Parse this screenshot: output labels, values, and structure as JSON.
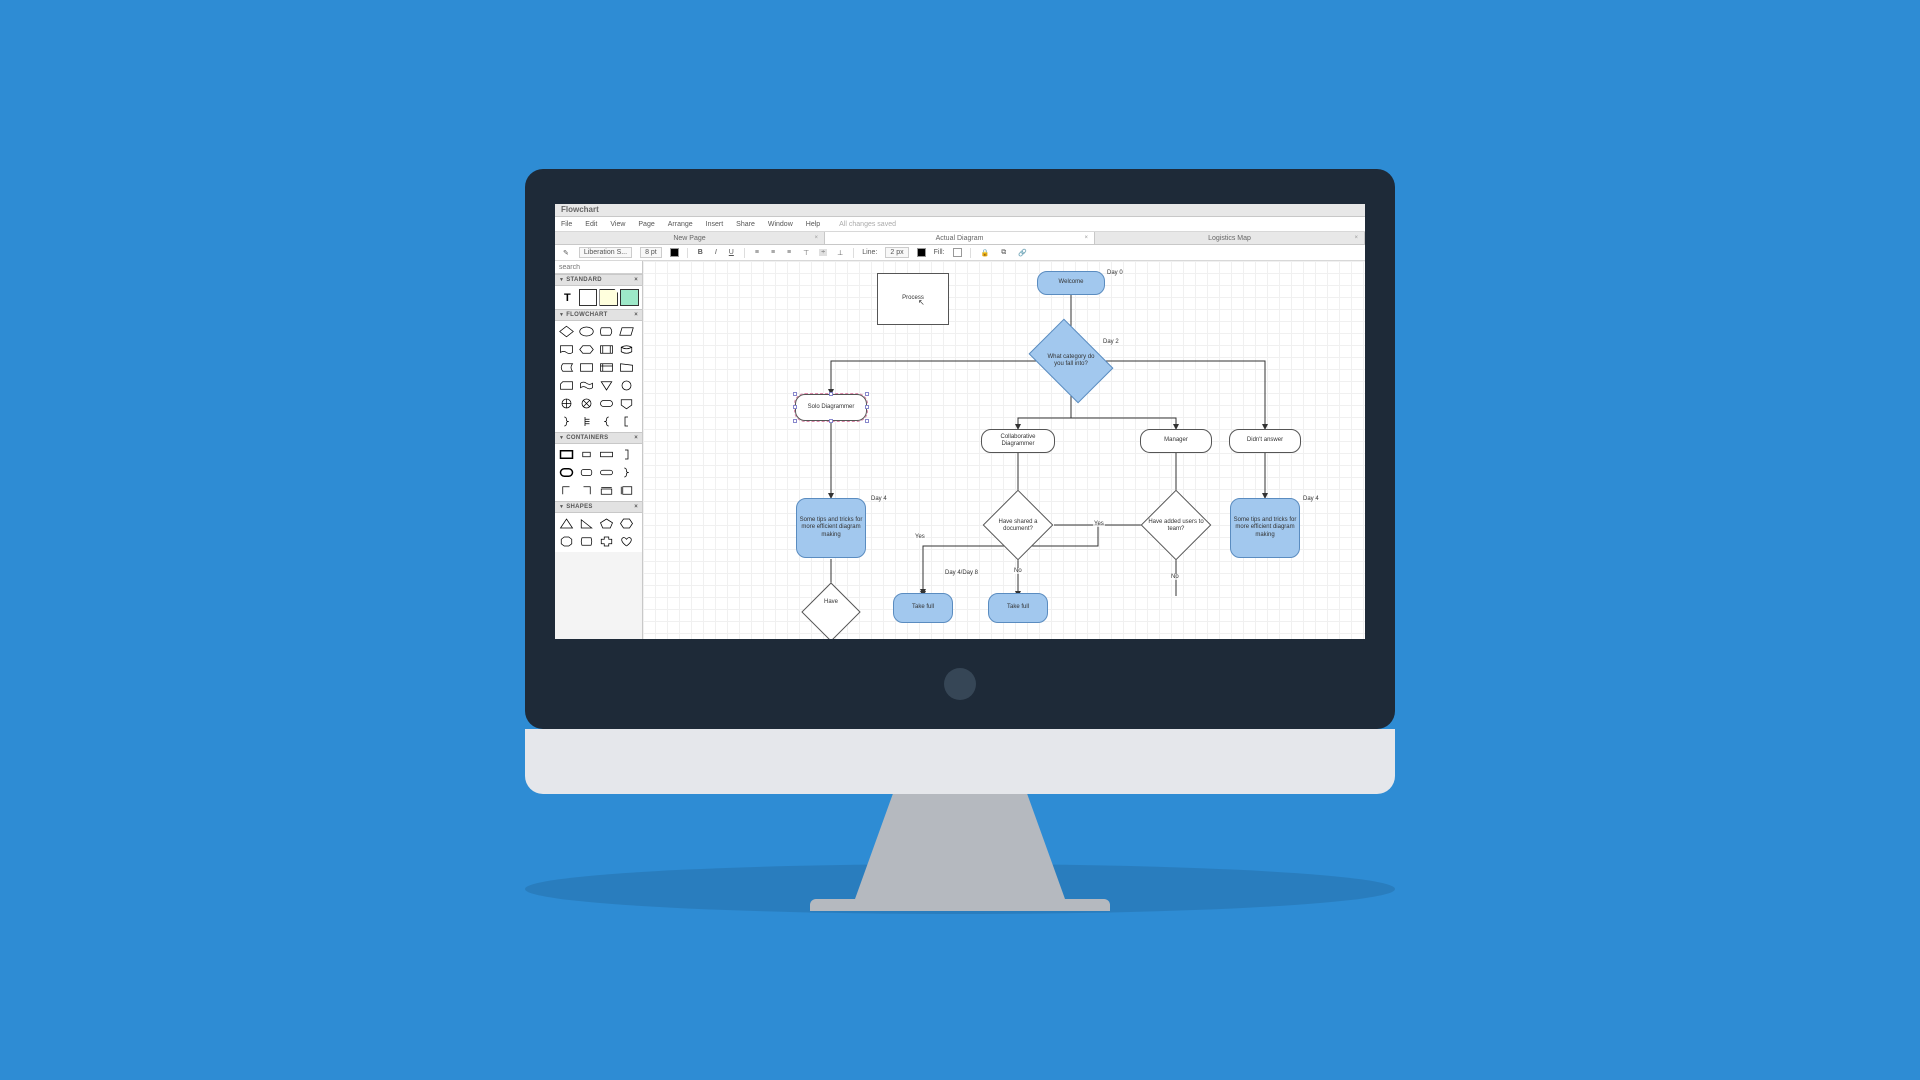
{
  "app": {
    "title": "Flowchart",
    "status": "All changes saved"
  },
  "menus": [
    "File",
    "Edit",
    "View",
    "Page",
    "Arrange",
    "Insert",
    "Share",
    "Window",
    "Help"
  ],
  "tabs": [
    {
      "label": "New Page",
      "active": false
    },
    {
      "label": "Actual Diagram",
      "active": true
    },
    {
      "label": "Logistics Map",
      "active": false
    }
  ],
  "toolbar": {
    "font": "Liberation S...",
    "fontSize": "8 pt",
    "textColor": "#000000",
    "lineLabel": "Line:",
    "lineWidth": "2 px",
    "lineColor": "#000000",
    "fillLabel": "Fill:",
    "fillColor": "#ffffff"
  },
  "panel": {
    "searchPlaceholder": "search",
    "sections": {
      "standard": "STANDARD",
      "flowchart": "FLOWCHART",
      "containers": "CONTAINERS",
      "shapes": "SHAPES"
    }
  },
  "diagram": {
    "nodes": {
      "process": "Process",
      "welcome": "Welcome",
      "category": "What category do you fall into?",
      "solo": "Solo Diagrammer",
      "collab": "Collaborative Diagrammer",
      "manager": "Manager",
      "noanswer": "Didn't answer",
      "tips1": "Some tips and tricks for more efficient diagram making",
      "tips2": "Some tips and tricks for more efficient diagram making",
      "shared": "Have shared a document?",
      "added": "Have added users to team?",
      "have": "Have",
      "takefull1": "Take full",
      "takefull2": "Take full"
    },
    "labels": {
      "day0": "Day 0",
      "day2": "Day 2",
      "day4a": "Day 4",
      "day4b": "Day 4",
      "day48": "Day 4/Day 8"
    },
    "edges": {
      "yes": "Yes",
      "no": "No"
    }
  }
}
